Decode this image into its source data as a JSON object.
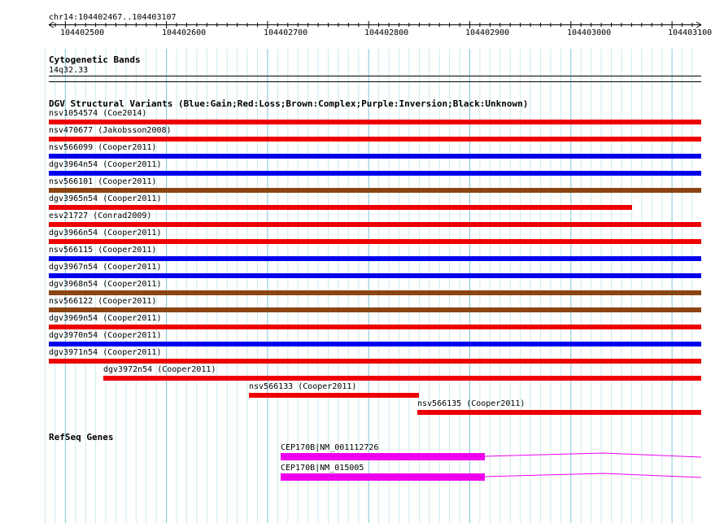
{
  "colors": {
    "gain": "#0000ee",
    "loss": "#ee0000",
    "complex": "#8b4513",
    "gene": "#ee00ee",
    "grid_major": "#7ec8d8",
    "grid_minor": "#cdeaf2"
  },
  "location": {
    "label": "chr14:104402467..104403107",
    "ticks": [
      "104402500",
      "104402600",
      "104402700",
      "104402800",
      "104402900",
      "104403000",
      "104403100"
    ]
  },
  "cytoband": {
    "title": "Cytogenetic Bands",
    "band": "14q32.33"
  },
  "dgv": {
    "title": "DGV Structural Variants (Blue:Gain;Red:Loss;Brown:Complex;Purple:Inversion;Black:Unknown)",
    "variants": [
      {
        "label": "nsv1054574 (Coe2014)",
        "type": "loss"
      },
      {
        "label": "nsv470677 (Jakobsson2008)",
        "type": "loss"
      },
      {
        "label": "nsv566099 (Cooper2011)",
        "type": "gain"
      },
      {
        "label": "dgv3964n54 (Cooper2011)",
        "type": "gain"
      },
      {
        "label": "nsv566101 (Cooper2011)",
        "type": "complex"
      },
      {
        "label": "dgv3965n54 (Cooper2011)",
        "type": "loss"
      },
      {
        "label": "esv21727 (Conrad2009)",
        "type": "loss"
      },
      {
        "label": "dgv3966n54 (Cooper2011)",
        "type": "loss"
      },
      {
        "label": "nsv566115 (Cooper2011)",
        "type": "gain"
      },
      {
        "label": "dgv3967n54 (Cooper2011)",
        "type": "gain"
      },
      {
        "label": "dgv3968n54 (Cooper2011)",
        "type": "complex"
      },
      {
        "label": "nsv566122 (Cooper2011)",
        "type": "complex"
      },
      {
        "label": "dgv3969n54 (Cooper2011)",
        "type": "loss"
      },
      {
        "label": "dgv3970n54 (Cooper2011)",
        "type": "gain"
      },
      {
        "label": "dgv3971n54 (Cooper2011)",
        "type": "loss"
      },
      {
        "label": "dgv3972n54 (Cooper2011)",
        "type": "loss"
      },
      {
        "label": "nsv566133 (Cooper2011)",
        "type": "loss"
      },
      {
        "label": "nsv566135 (Cooper2011)",
        "type": "loss"
      }
    ]
  },
  "refseq": {
    "title": "RefSeq Genes",
    "genes": [
      {
        "label": "CEP170B|NM_001112726"
      },
      {
        "label": "CEP170B|NM_015005"
      }
    ]
  }
}
